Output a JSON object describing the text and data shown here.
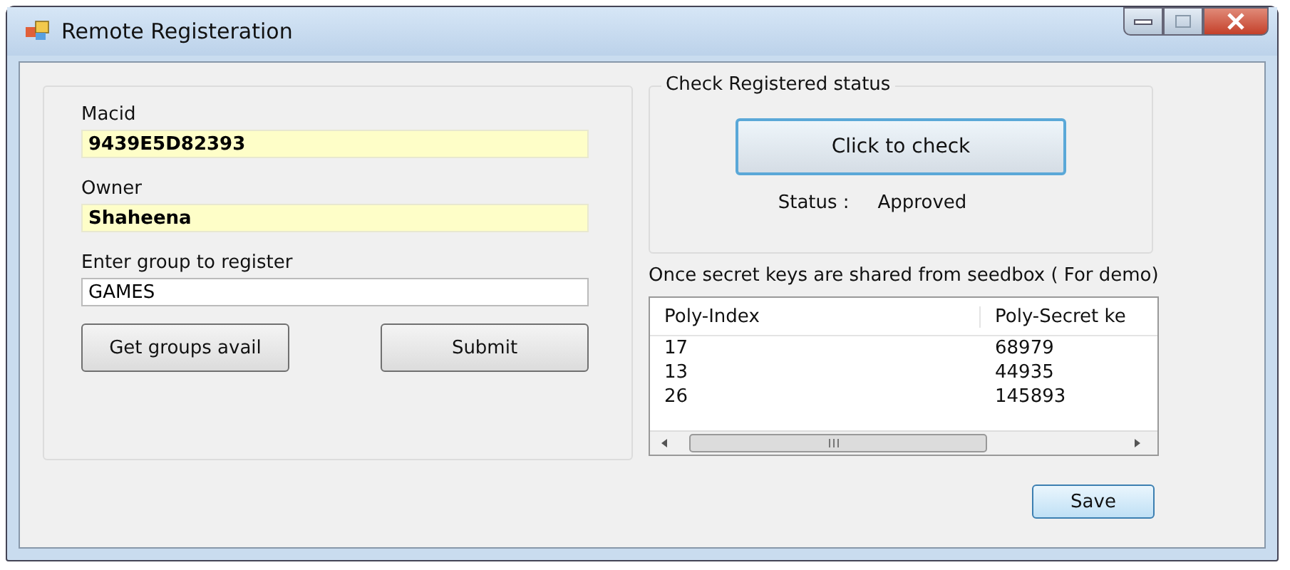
{
  "window": {
    "title": "Remote Registeration"
  },
  "registration": {
    "fields": [
      {
        "label": "Macid",
        "value": "9439E5D82393",
        "kind": "readonly"
      },
      {
        "label": "Owner",
        "value": "Shaheena",
        "kind": "readonly"
      },
      {
        "label": "Enter group to register",
        "value": "GAMES",
        "kind": "input"
      }
    ],
    "buttons": [
      "Get groups avail",
      "Submit"
    ]
  },
  "status_group": {
    "title": "Check Registered status",
    "button": "Click to check",
    "status_label": "Status :",
    "status_value": "Approved"
  },
  "keys_note": "Once secret keys are shared from seedbox  ( For demo)",
  "table": {
    "columns": [
      "Poly-Index",
      "Poly-Secret ke"
    ],
    "rows": [
      [
        "17",
        "68979"
      ],
      [
        "13",
        "44935"
      ],
      [
        "26",
        "145893"
      ]
    ]
  },
  "save_button": "Save"
}
